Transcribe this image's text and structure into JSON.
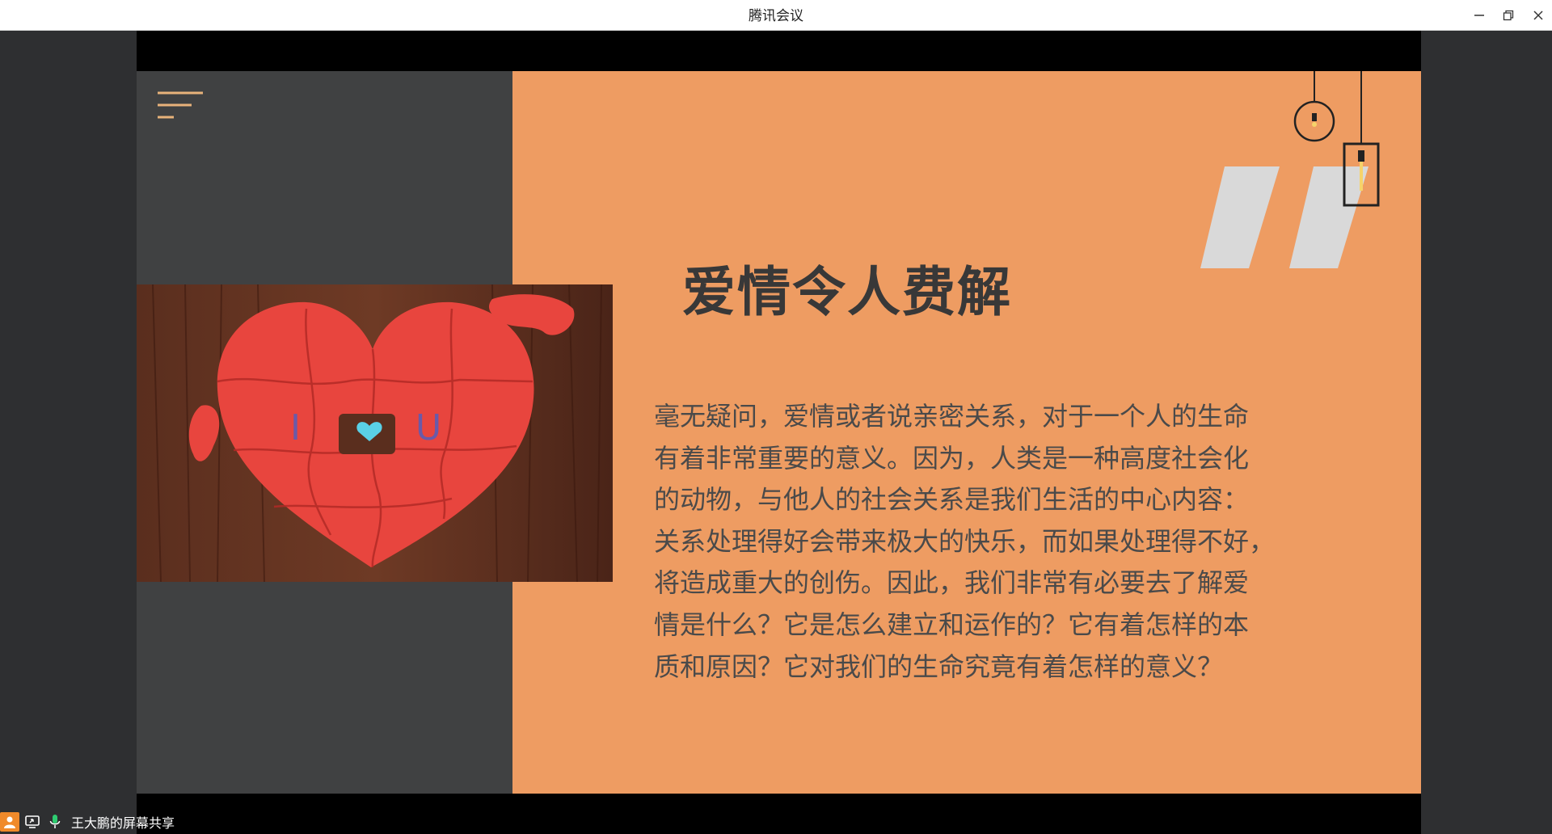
{
  "window": {
    "title": "腾讯会议"
  },
  "slide": {
    "title": "爱情令人费解",
    "body_lines": [
      "毫无疑问，爱情或者说亲密关系，对于一个人的生命",
      "有着非常重要的意义。因为，人类是一种高度社会化",
      "的动物，与他人的社会关系是我们生活的中心内容：",
      "关系处理得好会带来极大的快乐，而如果处理得不好，",
      "将造成重大的创伤。因此，我们非常有必要去了解爱",
      "情是什么？它是怎么建立和运作的？它有着怎样的本",
      "质和原因？它对我们的生命究竟有着怎样的意义？"
    ],
    "photo_letters": [
      "I",
      "U"
    ],
    "colors": {
      "left_panel": "#404142",
      "right_panel": "#ee9c62",
      "accent_lines": "#e8b27a",
      "heart": "#e8453e",
      "quote_mark": "#d9d9d9"
    }
  },
  "status": {
    "share_label": "王大鹏的屏幕共享",
    "icons": [
      "participant-icon",
      "screen-share-icon",
      "microphone-icon"
    ]
  }
}
